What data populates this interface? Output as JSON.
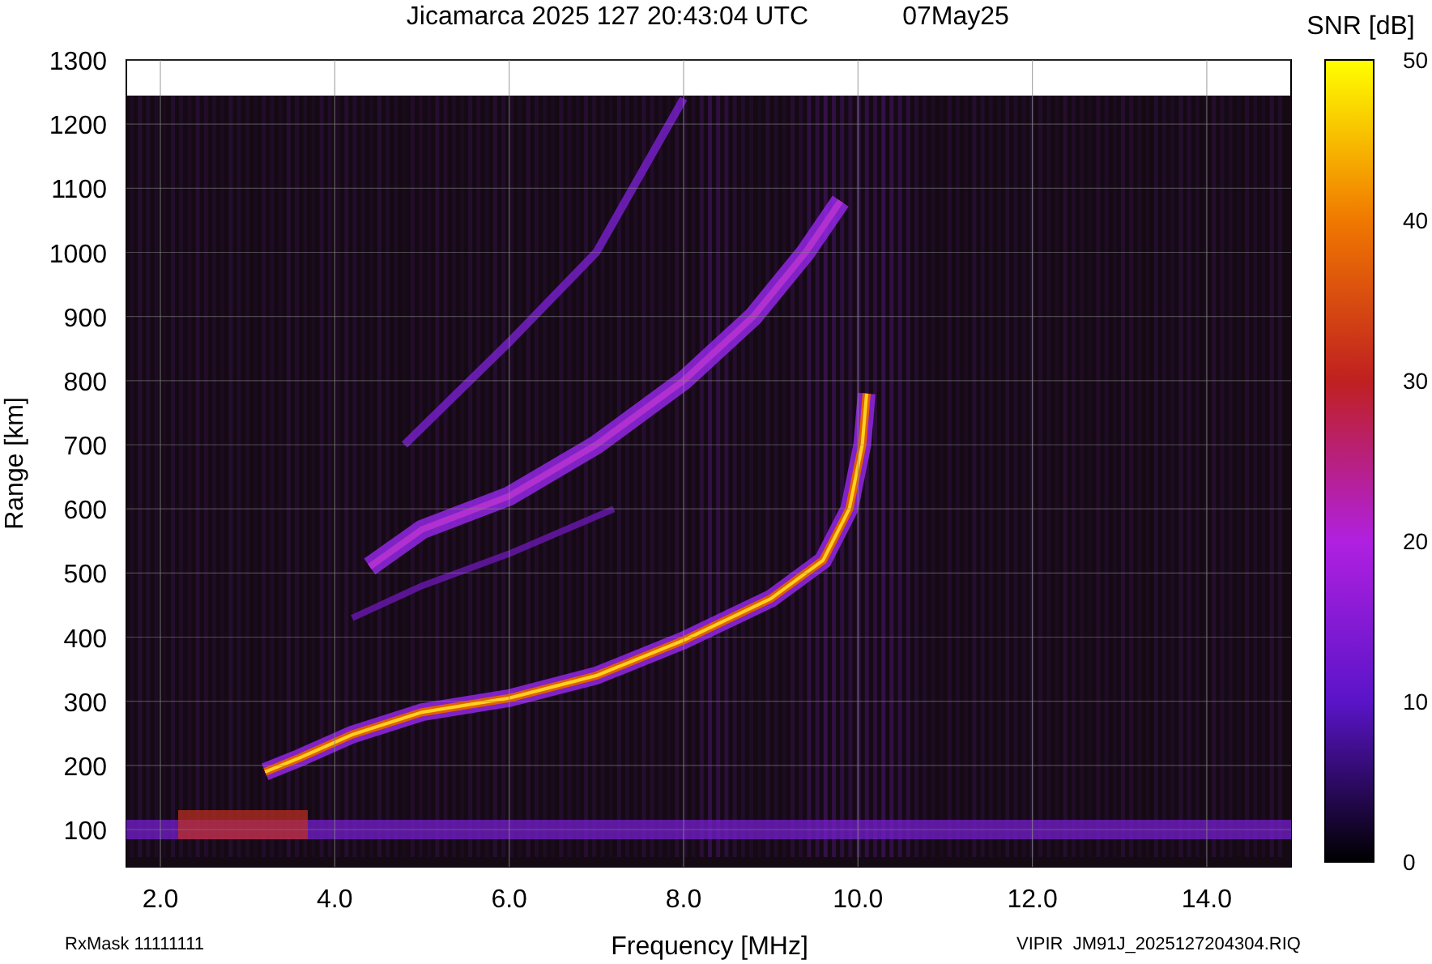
{
  "title": {
    "station": "Jicamarca 2025 127 20:43:04 UTC",
    "date": "07May25"
  },
  "plot": {
    "ylabel": "Range [km]",
    "xlabel": "Frequency [MHz]",
    "yticks": [
      "1300",
      "1200",
      "1100",
      "1000",
      "900",
      "800",
      "700",
      "600",
      "500",
      "400",
      "300",
      "200",
      "100"
    ],
    "xticks": [
      "2.0",
      "4.0",
      "6.0",
      "8.0",
      "10.0",
      "12.0",
      "14.0"
    ]
  },
  "colorbar": {
    "title": "SNR [dB]",
    "ticks": [
      "50",
      "40",
      "30",
      "20",
      "10",
      "0"
    ]
  },
  "footer": {
    "left": "RxMask 11111111",
    "right": "VIPIR  JM91J_2025127204304.RIQ"
  }
}
